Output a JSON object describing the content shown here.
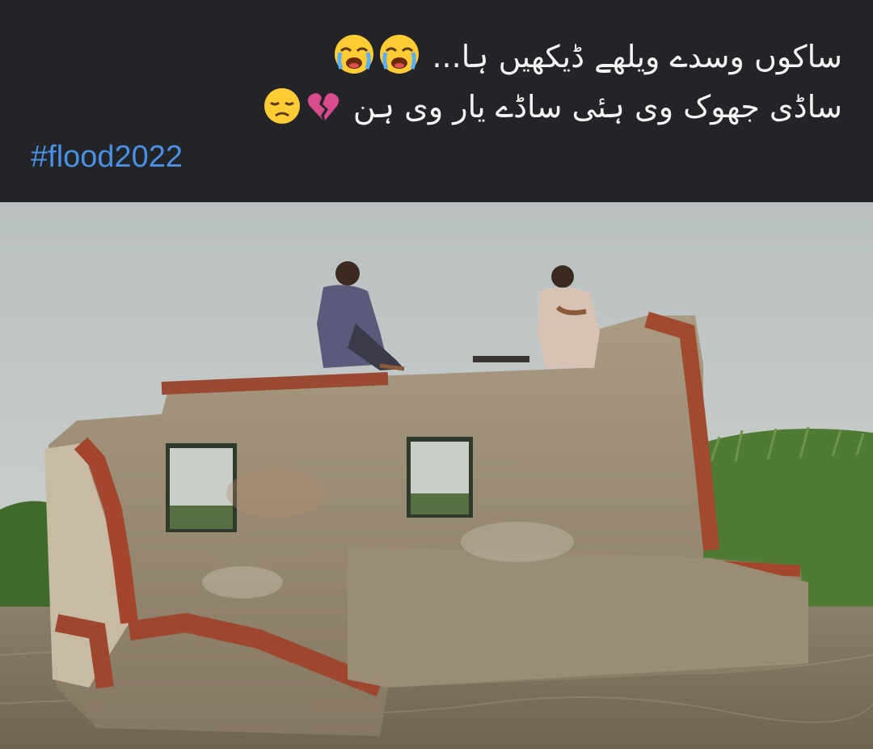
{
  "post": {
    "line1_text": "ساکوں وسدے ویلھے ڈیکھیں ہا...",
    "line2_text": "ساڈی جھوک وی ہئی ساڈے یار وی ہن",
    "hashtag": "#flood2022",
    "line1_emojis": [
      "loudly-crying-face-icon",
      "loudly-crying-face-icon"
    ],
    "line2_emojis": [
      "broken-heart-icon",
      "disappointed-face-icon"
    ]
  },
  "colors": {
    "background": "#232427",
    "text": "#f4f4f4",
    "hashtag": "#4a90e2"
  }
}
